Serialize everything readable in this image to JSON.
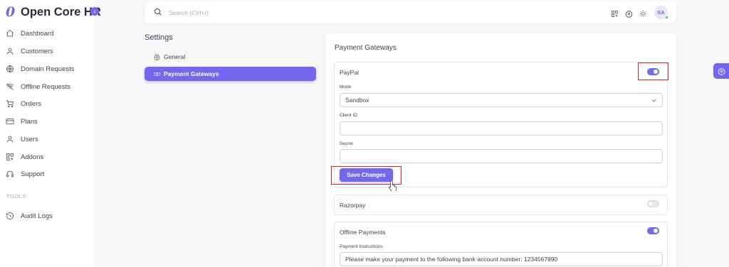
{
  "app": {
    "name": "Open Core HR"
  },
  "sidebar": {
    "items": [
      {
        "label": "Dashboard",
        "icon": "home-icon"
      },
      {
        "label": "Customers",
        "icon": "user-icon"
      },
      {
        "label": "Domain Requests",
        "icon": "globe-icon"
      },
      {
        "label": "Offline Requests",
        "icon": "wifi-off-icon"
      },
      {
        "label": "Orders",
        "icon": "cart-icon"
      },
      {
        "label": "Plans",
        "icon": "credit-card-icon"
      },
      {
        "label": "Users",
        "icon": "user-icon"
      },
      {
        "label": "Addons",
        "icon": "grid-plus-icon"
      },
      {
        "label": "Support",
        "icon": "headset-icon"
      }
    ],
    "section_tools": "TOOLS",
    "tools_items": [
      {
        "label": "Audit Logs",
        "icon": "history-icon"
      }
    ]
  },
  "topbar": {
    "search_placeholder": "Search (Ctrl+/)",
    "avatar_initials": "SA"
  },
  "settings": {
    "title": "Settings",
    "nav": [
      {
        "label": "General",
        "active": false
      },
      {
        "label": "Payment Gateways",
        "active": true
      }
    ]
  },
  "payment_gateways": {
    "title": "Payment Gateways",
    "paypal": {
      "name": "PayPal",
      "enabled": true,
      "mode_label": "Mode",
      "mode_value": "Sandbox",
      "client_id_label": "Client ID",
      "client_id_value": "",
      "secret_label": "Secret",
      "secret_value": "",
      "save_label": "Save Changes"
    },
    "razorpay": {
      "name": "Razorpay",
      "enabled": false
    },
    "offline": {
      "name": "Offline Payments",
      "enabled": true,
      "instructions_label": "Payment Instructions",
      "instructions_value": "Please make your payment to the following bank account number: 1234567890"
    }
  },
  "colors": {
    "primary": "#7367f0",
    "highlight": "#d8232a",
    "online": "#28c76f"
  }
}
